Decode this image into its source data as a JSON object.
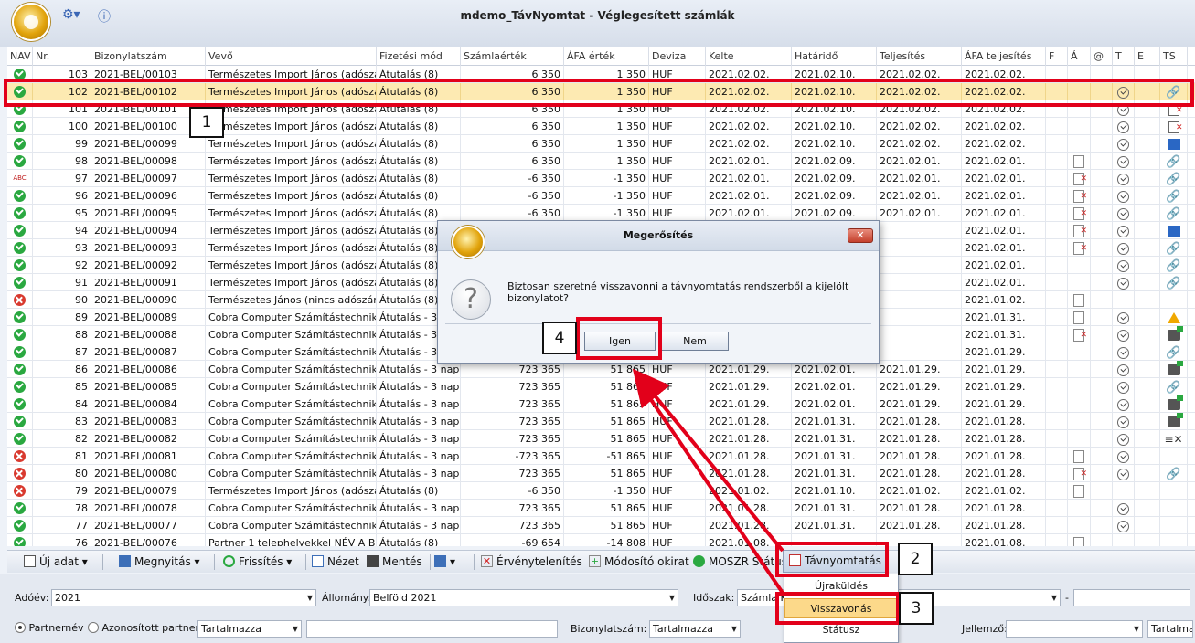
{
  "app": {
    "title": "mdemo_TávNyomtat - Véglegesített számlák"
  },
  "grid": {
    "columns": [
      "NAV",
      "Nr.",
      "Bizonylatszám",
      "Vevő",
      "Fizetési mód",
      "Számlaérték",
      "ÁFA érték",
      "Deviza",
      "Kelte",
      "Határidő",
      "Teljesítés",
      "ÁFA teljesítés",
      "F",
      "Á",
      "@",
      "T",
      "E",
      "TS"
    ],
    "rows": [
      {
        "status": "ok",
        "nr": "103",
        "biz": "2021-BEL/00103",
        "vevo": "Természetes Import János (adószá...",
        "fiz": "Átutalás (8)",
        "szv": "6 350",
        "afa": "1 350",
        "dev": "HUF",
        "kel": "2021.02.02.",
        "hat": "2021.02.10.",
        "tel": "2021.02.02.",
        "aft": "2021.02.02.",
        "a": "",
        "t": "",
        "ts": ""
      },
      {
        "status": "ok",
        "nr": "102",
        "biz": "2021-BEL/00102",
        "vevo": "Természetes Import János (adószá...",
        "fiz": "Átutalás (8)",
        "szv": "6 350",
        "afa": "1 350",
        "dev": "HUF",
        "kel": "2021.02.02.",
        "hat": "2021.02.10.",
        "tel": "2021.02.02.",
        "aft": "2021.02.02.",
        "a": "",
        "t": "check",
        "ts": "link",
        "selected": true
      },
      {
        "status": "ok",
        "nr": "101",
        "biz": "2021-BEL/00101",
        "vevo": "Természetes Import János (adószá...",
        "fiz": "Átutalás (8)",
        "szv": "6 350",
        "afa": "1 350",
        "dev": "HUF",
        "kel": "2021.02.02.",
        "hat": "2021.02.10.",
        "tel": "2021.02.02.",
        "aft": "2021.02.02.",
        "a": "",
        "t": "check",
        "ts": "docx"
      },
      {
        "status": "ok",
        "nr": "100",
        "biz": "2021-BEL/00100",
        "vevo": "Természetes Import János (adószá...",
        "fiz": "Átutalás (8)",
        "szv": "6 350",
        "afa": "1 350",
        "dev": "HUF",
        "kel": "2021.02.02.",
        "hat": "2021.02.10.",
        "tel": "2021.02.02.",
        "aft": "2021.02.02.",
        "a": "",
        "t": "check",
        "ts": "docx"
      },
      {
        "status": "ok",
        "nr": "99",
        "biz": "2021-BEL/00099",
        "vevo": "Természetes Import János (adószá...",
        "fiz": "Átutalás (8)",
        "szv": "6 350",
        "afa": "1 350",
        "dev": "HUF",
        "kel": "2021.02.02.",
        "hat": "2021.02.10.",
        "tel": "2021.02.02.",
        "aft": "2021.02.02.",
        "a": "",
        "t": "check",
        "ts": "net"
      },
      {
        "status": "ok",
        "nr": "98",
        "biz": "2021-BEL/00098",
        "vevo": "Természetes Import János (adószá...",
        "fiz": "Átutalás (8)",
        "szv": "6 350",
        "afa": "1 350",
        "dev": "HUF",
        "kel": "2021.02.01.",
        "hat": "2021.02.09.",
        "tel": "2021.02.01.",
        "aft": "2021.02.01.",
        "a": "doc",
        "t": "check",
        "ts": "link"
      },
      {
        "status": "abc",
        "nr": "97",
        "biz": "2021-BEL/00097",
        "vevo": "Természetes Import János (adószá...",
        "fiz": "Átutalás (8)",
        "szv": "-6 350",
        "afa": "-1 350",
        "dev": "HUF",
        "kel": "2021.02.01.",
        "hat": "2021.02.09.",
        "tel": "2021.02.01.",
        "aft": "2021.02.01.",
        "a": "docred",
        "t": "check",
        "ts": "link"
      },
      {
        "status": "ok",
        "nr": "96",
        "biz": "2021-BEL/00096",
        "vevo": "Természetes Import János (adószá...",
        "fiz": "Átutalás (8)",
        "szv": "-6 350",
        "afa": "-1 350",
        "dev": "HUF",
        "kel": "2021.02.01.",
        "hat": "2021.02.09.",
        "tel": "2021.02.01.",
        "aft": "2021.02.01.",
        "a": "docred",
        "t": "check",
        "ts": "link"
      },
      {
        "status": "ok",
        "nr": "95",
        "biz": "2021-BEL/00095",
        "vevo": "Természetes Import János (adószá...",
        "fiz": "Átutalás (8)",
        "szv": "-6 350",
        "afa": "-1 350",
        "dev": "HUF",
        "kel": "2021.02.01.",
        "hat": "2021.02.09.",
        "tel": "2021.02.01.",
        "aft": "2021.02.01.",
        "a": "docred",
        "t": "check",
        "ts": "link"
      },
      {
        "status": "ok",
        "nr": "94",
        "biz": "2021-BEL/00094",
        "vevo": "Természetes Import János (adószá...",
        "fiz": "Átutalás (8)",
        "szv": "",
        "afa": "",
        "dev": "",
        "kel": "",
        "hat": "",
        "tel": "",
        "aft": "2021.02.01.",
        "a": "docred",
        "t": "check",
        "ts": "net"
      },
      {
        "status": "ok",
        "nr": "93",
        "biz": "2021-BEL/00093",
        "vevo": "Természetes Import János (adószá...",
        "fiz": "Átutalás (8)",
        "szv": "",
        "afa": "",
        "dev": "",
        "kel": "",
        "hat": "",
        "tel": "",
        "aft": "2021.02.01.",
        "a": "docred",
        "t": "check",
        "ts": "link"
      },
      {
        "status": "ok",
        "nr": "92",
        "biz": "2021-BEL/00092",
        "vevo": "Természetes Import János (adószá...",
        "fiz": "Átutalás (8)",
        "szv": "",
        "afa": "",
        "dev": "",
        "kel": "",
        "hat": "",
        "tel": "",
        "aft": "2021.02.01.",
        "a": "",
        "t": "check",
        "ts": "link"
      },
      {
        "status": "ok",
        "nr": "91",
        "biz": "2021-BEL/00091",
        "vevo": "Természetes Import János (adószá...",
        "fiz": "Átutalás (8)",
        "szv": "",
        "afa": "",
        "dev": "",
        "kel": "",
        "hat": "",
        "tel": "",
        "aft": "2021.02.01.",
        "a": "",
        "t": "check",
        "ts": "link"
      },
      {
        "status": "err",
        "nr": "90",
        "biz": "2021-BEL/00090",
        "vevo": "Természetes János (nincs adószáma)",
        "fiz": "Átutalás (8)",
        "szv": "",
        "afa": "",
        "dev": "",
        "kel": "",
        "hat": "",
        "tel": "",
        "aft": "2021.01.02.",
        "a": "doc",
        "t": "",
        "ts": ""
      },
      {
        "status": "ok",
        "nr": "89",
        "biz": "2021-BEL/00089",
        "vevo": "Cobra Computer Számítástechnikai ...",
        "fiz": "Átutalás - 3 n",
        "szv": "",
        "afa": "",
        "dev": "",
        "kel": "",
        "hat": "",
        "tel": "",
        "aft": "2021.01.31.",
        "a": "doc",
        "t": "check",
        "ts": "warn"
      },
      {
        "status": "ok",
        "nr": "88",
        "biz": "2021-BEL/00088",
        "vevo": "Cobra Computer Számítástechnikai ...",
        "fiz": "Átutalás - 3 n",
        "szv": "",
        "afa": "",
        "dev": "",
        "kel": "",
        "hat": "",
        "tel": "",
        "aft": "2021.01.31.",
        "a": "docred",
        "t": "check",
        "ts": "print"
      },
      {
        "status": "ok",
        "nr": "87",
        "biz": "2021-BEL/00087",
        "vevo": "Cobra Computer Számítástechnikai ...",
        "fiz": "Átutalás - 3 n",
        "szv": "",
        "afa": "",
        "dev": "",
        "kel": "",
        "hat": "",
        "tel": "",
        "aft": "2021.01.29.",
        "a": "",
        "t": "check",
        "ts": "link"
      },
      {
        "status": "ok",
        "nr": "86",
        "biz": "2021-BEL/00086",
        "vevo": "Cobra Computer Számítástechnikai ...",
        "fiz": "Átutalás - 3 nap",
        "szv": "723 365",
        "afa": "51 865",
        "dev": "HUF",
        "kel": "2021.01.29.",
        "hat": "2021.02.01.",
        "tel": "2021.01.29.",
        "aft": "2021.01.29.",
        "a": "",
        "t": "check",
        "ts": "print"
      },
      {
        "status": "ok",
        "nr": "85",
        "biz": "2021-BEL/00085",
        "vevo": "Cobra Computer Számítástechnikai ...",
        "fiz": "Átutalás - 3 nap",
        "szv": "723 365",
        "afa": "51 865",
        "dev": "HUF",
        "kel": "2021.01.29.",
        "hat": "2021.02.01.",
        "tel": "2021.01.29.",
        "aft": "2021.01.29.",
        "a": "",
        "t": "check",
        "ts": "link"
      },
      {
        "status": "ok",
        "nr": "84",
        "biz": "2021-BEL/00084",
        "vevo": "Cobra Computer Számítástechnikai ...",
        "fiz": "Átutalás - 3 nap",
        "szv": "723 365",
        "afa": "51 865",
        "dev": "HUF",
        "kel": "2021.01.29.",
        "hat": "2021.02.01.",
        "tel": "2021.01.29.",
        "aft": "2021.01.29.",
        "a": "",
        "t": "check",
        "ts": "print"
      },
      {
        "status": "ok",
        "nr": "83",
        "biz": "2021-BEL/00083",
        "vevo": "Cobra Computer Számítástechnikai ...",
        "fiz": "Átutalás - 3 nap",
        "szv": "723 365",
        "afa": "51 865",
        "dev": "HUF",
        "kel": "2021.01.28.",
        "hat": "2021.01.31.",
        "tel": "2021.01.28.",
        "aft": "2021.01.28.",
        "a": "",
        "t": "check",
        "ts": "print"
      },
      {
        "status": "ok",
        "nr": "82",
        "biz": "2021-BEL/00082",
        "vevo": "Cobra Computer Számítástechnikai ...",
        "fiz": "Átutalás - 3 nap",
        "szv": "723 365",
        "afa": "51 865",
        "dev": "HUF",
        "kel": "2021.01.28.",
        "hat": "2021.01.31.",
        "tel": "2021.01.28.",
        "aft": "2021.01.28.",
        "a": "",
        "t": "check",
        "ts": "list"
      },
      {
        "status": "err",
        "nr": "81",
        "biz": "2021-BEL/00081",
        "vevo": "Cobra Computer Számítástechnikai ...",
        "fiz": "Átutalás - 3 nap",
        "szv": "-723 365",
        "afa": "-51 865",
        "dev": "HUF",
        "kel": "2021.01.28.",
        "hat": "2021.01.31.",
        "tel": "2021.01.28.",
        "aft": "2021.01.28.",
        "a": "doc",
        "t": "check",
        "ts": ""
      },
      {
        "status": "err",
        "nr": "80",
        "biz": "2021-BEL/00080",
        "vevo": "Cobra Computer Számítástechnikai ...",
        "fiz": "Átutalás - 3 nap",
        "szv": "723 365",
        "afa": "51 865",
        "dev": "HUF",
        "kel": "2021.01.28.",
        "hat": "2021.01.31.",
        "tel": "2021.01.28.",
        "aft": "2021.01.28.",
        "a": "docred",
        "t": "check",
        "ts": "link"
      },
      {
        "status": "err",
        "nr": "79",
        "biz": "2021-BEL/00079",
        "vevo": "Természetes Import János (adószá...",
        "fiz": "Átutalás (8)",
        "szv": "-6 350",
        "afa": "-1 350",
        "dev": "HUF",
        "kel": "2021.01.02.",
        "hat": "2021.01.10.",
        "tel": "2021.01.02.",
        "aft": "2021.01.02.",
        "a": "doc",
        "t": "",
        "ts": ""
      },
      {
        "status": "ok",
        "nr": "78",
        "biz": "2021-BEL/00078",
        "vevo": "Cobra Computer Számítástechnikai ...",
        "fiz": "Átutalás - 3 nap",
        "szv": "723 365",
        "afa": "51 865",
        "dev": "HUF",
        "kel": "2021.01.28.",
        "hat": "2021.01.31.",
        "tel": "2021.01.28.",
        "aft": "2021.01.28.",
        "a": "",
        "t": "check",
        "ts": ""
      },
      {
        "status": "ok",
        "nr": "77",
        "biz": "2021-BEL/00077",
        "vevo": "Cobra Computer Számítástechnikai ...",
        "fiz": "Átutalás - 3 nap",
        "szv": "723 365",
        "afa": "51 865",
        "dev": "HUF",
        "kel": "2021.01.28.",
        "hat": "2021.01.31.",
        "tel": "2021.01.28.",
        "aft": "2021.01.28.",
        "a": "",
        "t": "check",
        "ts": ""
      },
      {
        "status": "ok",
        "nr": "76",
        "biz": "2021-BEL/00076",
        "vevo": "Partner 1 telephelyekkel NÉV A BIZ...",
        "fiz": "Átutalás (8)",
        "szv": "-69 654",
        "afa": "-14 808",
        "dev": "HUF",
        "kel": "2021.01.08.",
        "hat": "",
        "tel": "",
        "aft": "2021.01.08.",
        "a": "doc",
        "t": "",
        "ts": ""
      }
    ]
  },
  "toolbar": {
    "new": "Új adat",
    "open": "Megnyitás",
    "refresh": "Frissítés",
    "view": "Nézet",
    "save": "Mentés",
    "invalidate": "Érvénytelenítés",
    "modify": "Módosító okirat",
    "moszr": "MOSZR Státusz",
    "remote_print": "Távnyomtatás"
  },
  "menu": {
    "items": [
      "Újraküldés",
      "Visszavonás",
      "Státusz"
    ]
  },
  "filters": {
    "year_label": "Adóév:",
    "year_value": "2021",
    "stock_label": "Állomány:",
    "stock_value": "Belföld 2021",
    "period_label": "Időszak:",
    "period_value": "Számla K",
    "dash": "-",
    "partner_radio": "Partnernév",
    "ident_radio": "Azonosított partner",
    "partner_mode": "Tartalmazza",
    "doc_label": "Bizonylatszám:",
    "doc_mode": "Tartalmazza",
    "char_label": "Jellemző:",
    "char_mode": "Tartalmazza"
  },
  "dialog": {
    "title": "Megerősítés",
    "message": "Biztosan szeretné visszavonni a távnyomtatás rendszerből a kijelölt bizonylatot?",
    "yes": "Igen",
    "no": "Nem",
    "close": "✕"
  },
  "annotations": [
    "1",
    "2",
    "3",
    "4"
  ],
  "colors": {
    "highlight": "#e2001a",
    "selected_row": "#fdeab2"
  }
}
